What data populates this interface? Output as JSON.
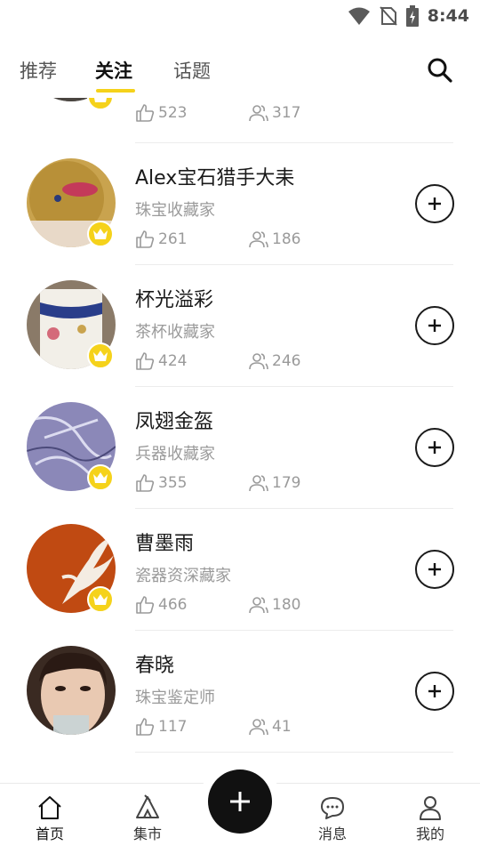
{
  "status": {
    "time": "8:44"
  },
  "tabs": [
    {
      "label": "推荐",
      "active": false
    },
    {
      "label": "关注",
      "active": true
    },
    {
      "label": "话题",
      "active": false
    }
  ],
  "users": [
    {
      "name": "",
      "role": "",
      "likes": "523",
      "followers": "317"
    },
    {
      "name": "Alex宝石猎手大耒",
      "role": "珠宝收藏家",
      "likes": "261",
      "followers": "186"
    },
    {
      "name": "杯光溢彩",
      "role": "茶杯收藏家",
      "likes": "424",
      "followers": "246"
    },
    {
      "name": "凤翅金盔",
      "role": "兵器收藏家",
      "likes": "355",
      "followers": "179"
    },
    {
      "name": "曹墨雨",
      "role": "瓷器资深藏家",
      "likes": "466",
      "followers": "180"
    },
    {
      "name": "春晓",
      "role": "珠宝鉴定师",
      "likes": "117",
      "followers": "41"
    }
  ],
  "nav": {
    "home": "首页",
    "market": "集市",
    "messages": "消息",
    "mine": "我的"
  },
  "colors": {
    "accent": "#f5d21b",
    "text": "#1a1a1a",
    "muted": "#9a9a9a"
  },
  "icons": {
    "search": "search-icon",
    "like": "thumbs-up-icon",
    "followers": "users-icon",
    "follow": "plus-icon",
    "crown": "crown-icon"
  }
}
